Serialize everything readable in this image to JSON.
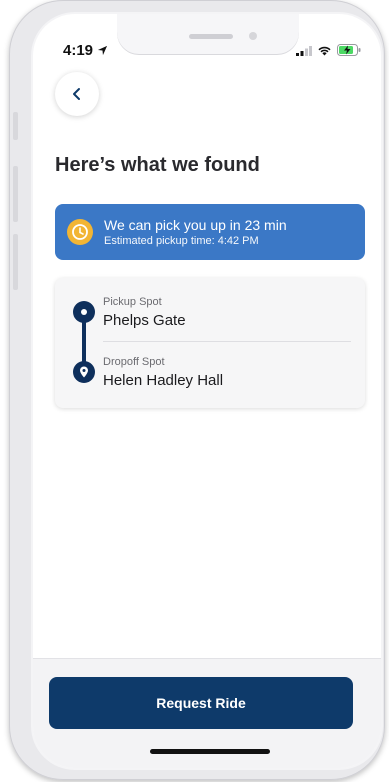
{
  "status_bar": {
    "time": "4:19",
    "icons": [
      "location-arrow-icon",
      "cellular-signal-icon",
      "wifi-icon",
      "battery-charging-icon"
    ]
  },
  "header": {
    "back_icon": "chevron-left-icon",
    "title": "Here’s what we found"
  },
  "eta": {
    "icon": "clock-icon",
    "main": "We can pick you up in 23 min",
    "sub": "Estimated pickup time: 4:42 PM"
  },
  "route": {
    "pickup": {
      "caption": "Pickup Spot",
      "name": "Phelps Gate",
      "icon": "pickup-dot-icon"
    },
    "dropoff": {
      "caption": "Dropoff Spot",
      "name": "Helen Hadley Hall",
      "icon": "map-pin-icon"
    }
  },
  "footer": {
    "request_label": "Request Ride"
  },
  "colors": {
    "accent_blue": "#3b78c6",
    "navy": "#0e3a6a",
    "clock_yellow": "#f2b534"
  }
}
